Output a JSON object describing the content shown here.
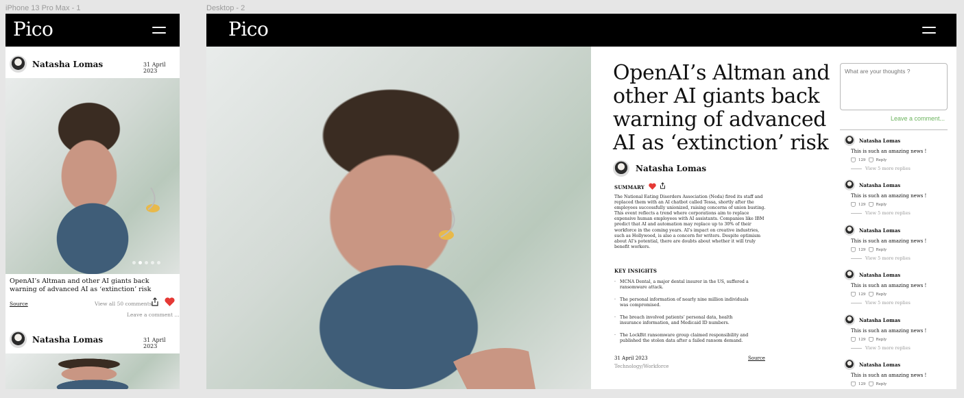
{
  "frames": {
    "mobile_label": "iPhone 13 Pro Max - 1",
    "desktop_label": "Desktop - 2"
  },
  "brand": {
    "logo": "Pico"
  },
  "icons": {
    "menu": "hamburger-menu-icon",
    "like": "heart-icon",
    "share": "share-icon",
    "upvote": "thumbs-up-icon",
    "reply": "reply-icon"
  },
  "colors": {
    "header": "#000000",
    "accent_like": "#e53935",
    "leave_comment": "#6bb35d"
  },
  "article": {
    "title": "OpenAI’s Altman and other AI giants back warning of advanced AI as ‘extinction’ risk",
    "author": "Natasha Lomas",
    "date": "31 April 2023",
    "category": "Technology/Workforce",
    "source_label": "Source",
    "summary_label": "SUMMARY",
    "summary": "The National Eating Disorders Association (Neda) fired its staff and replaced them with an AI chatbot called Tessa, shortly after the employees successfully unionized, raising concerns of union busting. This event reflects a trend where corporations aim to replace expensive human employees with AI assistants. Companies like IBM predict that AI and automation may replace up to 30% of their workforce in the coming years. AI’s impact on creative industries, such as Hollywood, is also a concern for writers. Despite optimism about AI’s potential, there are doubts about whether it will truly benefit workers.",
    "insights_label": "KEY INSIGHTS",
    "insights": [
      "MCNA Dental, a major dental insurer in the US, suffered a ransomware attack.",
      "The personal information of nearly nine million individuals was compromised.",
      "The breach involved patients’ personal data, health insurance information, and Medicaid ID numbers.",
      "The LockBit ransomware group claimed responsibility and published the stolen data after a failed ransom demand."
    ]
  },
  "mobile": {
    "card1": {
      "author": "Natasha Lomas",
      "date": "31 April 2023"
    },
    "caption": "OpenAI’s Altman and other AI giants back warning of advanced AI as ‘extinction’ risk",
    "source": "Source",
    "view_all": "View all 50 comments",
    "leave_comment": "Leave a comment ...",
    "carousel_active_index": 1,
    "carousel_count": 5,
    "card2": {
      "author": "Natasha Lomas",
      "date": "31 April 2023"
    }
  },
  "comments_panel": {
    "placeholder": "What are your thoughts ?",
    "leave_comment": "Leave a comment...",
    "comments": [
      {
        "author": "Natasha Lomas",
        "text": "This is such an amazing news !",
        "likes": "129",
        "reply": "Reply",
        "more": "View 5 more replies"
      },
      {
        "author": "Natasha Lomas",
        "text": "This is such an amazing news !",
        "likes": "129",
        "reply": "Reply",
        "more": "View 5 more replies"
      },
      {
        "author": "Natasha Lomas",
        "text": "This is such an amazing news !",
        "likes": "129",
        "reply": "Reply",
        "more": "View 5 more replies"
      },
      {
        "author": "Natasha Lomas",
        "text": "This is such an amazing news !",
        "likes": "129",
        "reply": "Reply",
        "more": "View 5 more replies"
      },
      {
        "author": "Natasha Lomas",
        "text": "This is such an amazing news !",
        "likes": "129",
        "reply": "Reply",
        "more": "View 5 more replies"
      },
      {
        "author": "Natasha Lomas",
        "text": "This is such an amazing news !",
        "likes": "129",
        "reply": "Reply",
        "more": ""
      }
    ]
  }
}
